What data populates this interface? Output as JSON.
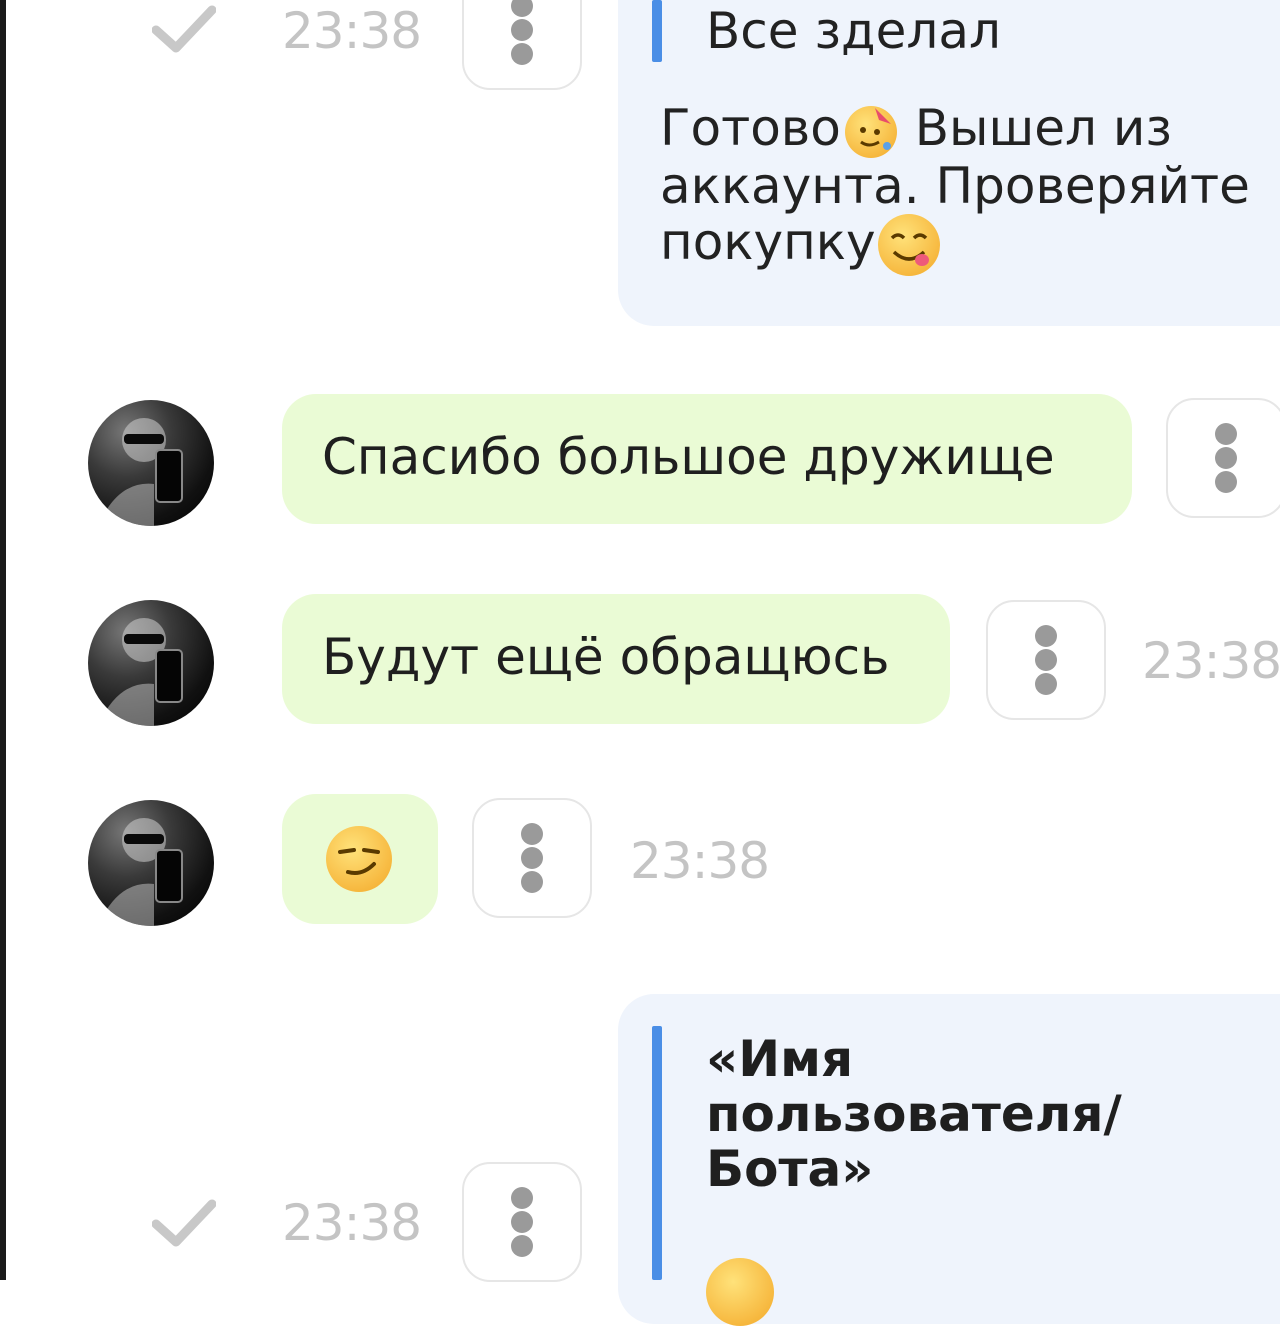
{
  "messages": [
    {
      "direction": "outgoing",
      "time": "23:38",
      "quote": "Все зделал",
      "text_line1": "Готово",
      "text_after_emoji": " Вышел из",
      "text_line2": "аккаунта. Проверяйте",
      "text_line3": "покупку",
      "icons": [
        "check-icon",
        "more-vertical-icon",
        "party-face-emoji",
        "yum-face-emoji"
      ]
    },
    {
      "direction": "incoming",
      "text": "Спасибо большое дружище",
      "icons": [
        "avatar",
        "more-vertical-icon"
      ]
    },
    {
      "direction": "incoming",
      "text": "Будут ещё обращюсь",
      "time": "23:38",
      "icons": [
        "avatar",
        "more-vertical-icon"
      ]
    },
    {
      "direction": "incoming",
      "emoji": "smirk-face-emoji",
      "time": "23:38",
      "icons": [
        "avatar",
        "more-vertical-icon"
      ]
    },
    {
      "direction": "outgoing",
      "time": "23:38",
      "quote_name_line1": "«Имя",
      "quote_name_line2": "пользователя/",
      "quote_name_line3": "Бота»",
      "icons": [
        "check-icon",
        "more-vertical-icon"
      ]
    }
  ],
  "colors": {
    "incoming_bubble": "#eafbd5",
    "outgoing_bubble": "#eff4fc",
    "quote_bar": "#4a8ee6",
    "time_text": "#c4c4c4"
  }
}
